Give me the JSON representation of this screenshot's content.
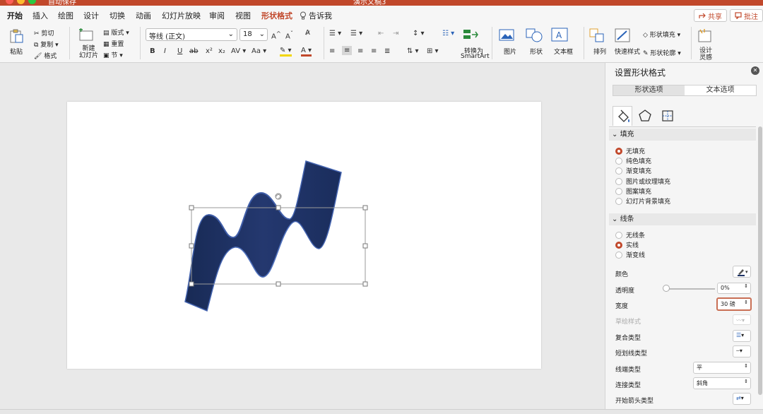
{
  "window": {
    "title": "演示文稿3",
    "autosave_label": "自动保存",
    "traffic_light_colors": [
      "#fc5f57",
      "#fdbc2e",
      "#28c941"
    ]
  },
  "tabs": [
    {
      "label": "开始",
      "active": true
    },
    {
      "label": "插入"
    },
    {
      "label": "绘图"
    },
    {
      "label": "设计"
    },
    {
      "label": "切换"
    },
    {
      "label": "动画"
    },
    {
      "label": "幻灯片放映"
    },
    {
      "label": "审阅"
    },
    {
      "label": "视图"
    },
    {
      "label": "形状格式",
      "context": true
    },
    {
      "label": "告诉我"
    }
  ],
  "top_buttons": {
    "share": "共享",
    "comment": "批注"
  },
  "ribbon": {
    "paste": "粘贴",
    "cut": "剪切",
    "copy": "复制",
    "format_painter": "格式",
    "new_slide": "新建\n幻灯片",
    "layout": "版式",
    "reset": "重置",
    "section": "节",
    "font_name": "等线 (正文)",
    "font_size": "18",
    "bold": "B",
    "italic": "I",
    "underline": "U",
    "strike": "ab",
    "superscript": "x²",
    "subscript": "x₂",
    "convert_smartart_1": "转换为",
    "convert_smartart_2": "SmartArt",
    "picture": "图片",
    "shape": "形状",
    "textbox": "文本框",
    "arrange": "排列",
    "quick_styles": "快速样式",
    "shape_fill": "形状填充",
    "shape_outline": "形状轮廓",
    "designer_1": "设计",
    "designer_2": "灵感"
  },
  "pane": {
    "title": "设置形状格式",
    "tab_shape": "形状选项",
    "tab_text": "文本选项",
    "fill_section": "填充",
    "fill_options": [
      "无填充",
      "纯色填充",
      "渐变填充",
      "图片或纹理填充",
      "图案填充",
      "幻灯片背景填充"
    ],
    "fill_selected": "无填充",
    "line_section": "线条",
    "line_options": [
      "无线条",
      "实线",
      "渐变线"
    ],
    "line_selected": "实线",
    "color_label": "颜色",
    "transparency_label": "透明度",
    "transparency_value": "0%",
    "width_label": "宽度",
    "width_value": "30 磅",
    "sketch_label": "草绘样式",
    "compound_label": "复合类型",
    "dash_label": "短划线类型",
    "cap_label": "线端类型",
    "cap_value": "平",
    "join_label": "连接类型",
    "join_value": "斜角",
    "arrow_label": "开始箭头类型"
  },
  "colors": {
    "accent": "#c1482b",
    "ribbon_shape": "#1f3466",
    "ribbon_edge": "#4464b0"
  },
  "icons": [
    "paint-bucket-icon",
    "pentagon-icon",
    "size-layout-icon",
    "lightbulb-icon",
    "share-icon",
    "comment-icon",
    "close-icon"
  ]
}
